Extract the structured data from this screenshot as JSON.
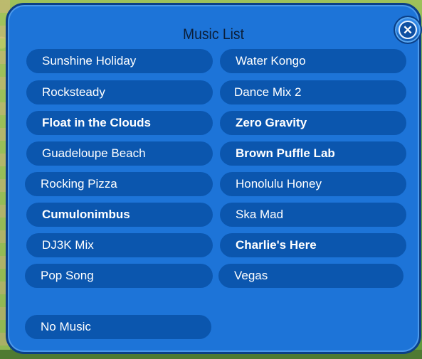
{
  "dialog": {
    "title": "Music List",
    "close_icon": "x-close-icon"
  },
  "songs_left": [
    {
      "label": "Sunshine Holiday",
      "bold": false
    },
    {
      "label": "Rocksteady",
      "bold": false
    },
    {
      "label": "Float in the Clouds",
      "bold": true
    },
    {
      "label": "Guadeloupe Beach",
      "bold": false
    },
    {
      "label": "Rocking Pizza",
      "bold": false
    },
    {
      "label": "Cumulonimbus",
      "bold": true
    },
    {
      "label": "DJ3K Mix",
      "bold": false
    },
    {
      "label": "Pop Song",
      "bold": false
    }
  ],
  "songs_right": [
    {
      "label": "Water Kongo",
      "bold": false
    },
    {
      "label": "Dance Mix 2",
      "bold": false
    },
    {
      "label": "Zero Gravity",
      "bold": true
    },
    {
      "label": "Brown Puffle Lab",
      "bold": true
    },
    {
      "label": "Honolulu Honey",
      "bold": false
    },
    {
      "label": "Ska Mad",
      "bold": false
    },
    {
      "label": "Charlie's Here",
      "bold": true
    },
    {
      "label": "Vegas",
      "bold": false
    }
  ],
  "no_music": {
    "label": "No Music"
  },
  "colors": {
    "panel": "#1d74d8",
    "button": "#0b56ae",
    "border": "#0b3f86"
  }
}
